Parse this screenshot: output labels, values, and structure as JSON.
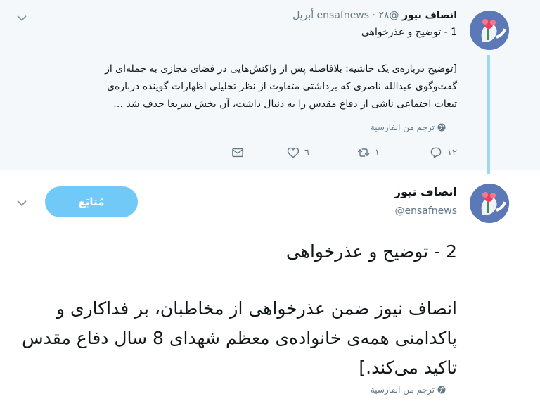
{
  "reply_tweet": {
    "author_name": "انصاف نیوز",
    "handle": "@ensafnews",
    "separator": "·",
    "date": "۲۸ أبريل",
    "subject": "1 - توضیح و عذرخواهی",
    "body": "[توضیح درباره‌ی یک حاشیه: بلافاصله پس از واکنش‌هایی در فضای مجازی به جمله‌ای از گفت‌وگوی عبدالله ناصری که برداشتی متفاوت از نظر تحلیلی اظهارات گوینده درباره‌ی تبعات اجتماعی ناشی از دفاع مقدس را به دنبال داشت، آن بخش سریعا حذف شد …",
    "translate_label": "ترجم من الفارسية",
    "counts": {
      "replies": "١٢",
      "retweets": "١",
      "likes": "٦"
    }
  },
  "main_tweet": {
    "author_name": "انصاف نیوز",
    "handle": "@ensafnews",
    "follow_label": "مُتابَع",
    "subject": "2 - توضیح و عذرخواهی",
    "body": "انصاف نیوز ضمن عذرخواهی از مخاطبان، بر فداکاری و پاکدامنی همه‌ی خانواده‌ی معظم شهدای 8 سال دفاع مقدس تاکید می‌کند.]",
    "translate_label": "ترجم من الفارسية"
  },
  "colors": {
    "accent": "#71c9f8",
    "thread_line": "#9cd6f9",
    "muted_text": "#657786",
    "reply_background": "#f5f8fa"
  },
  "icons": {
    "menu": "chevron-down-icon",
    "reply": "reply-icon",
    "retweet": "retweet-icon",
    "like": "heart-icon",
    "message": "envelope-icon",
    "translate": "globe-icon"
  }
}
